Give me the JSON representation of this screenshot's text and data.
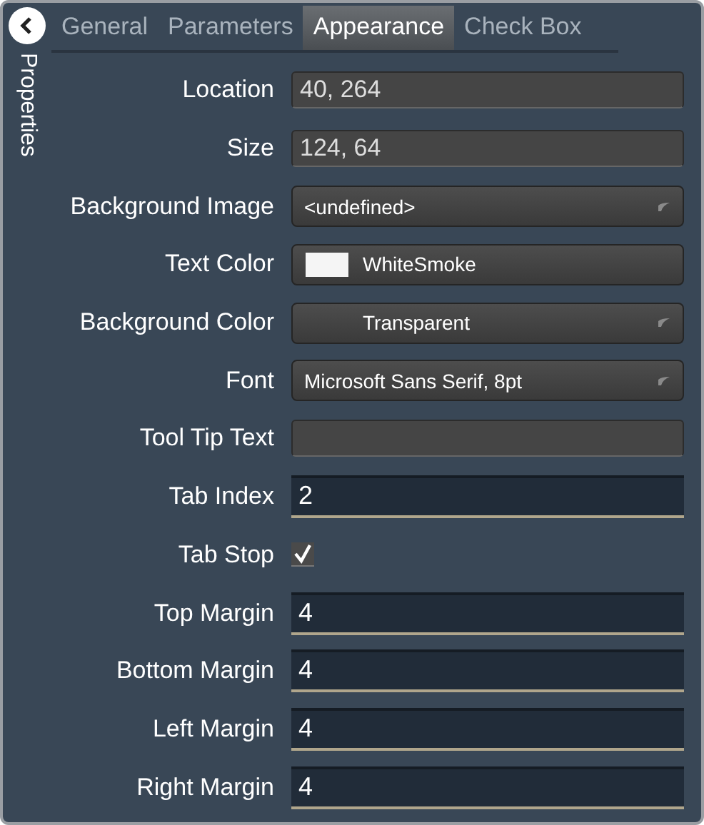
{
  "sidebar": {
    "title": "Properties"
  },
  "tabs": [
    {
      "label": "General",
      "selected": false
    },
    {
      "label": "Parameters",
      "selected": false
    },
    {
      "label": "Appearance",
      "selected": true
    },
    {
      "label": "Check Box",
      "selected": false
    }
  ],
  "properties": [
    {
      "label": "Location",
      "kind": "text",
      "value": "40, 264"
    },
    {
      "label": "Size",
      "kind": "text",
      "value": "124, 64"
    },
    {
      "label": "Background Image",
      "kind": "dropdown",
      "value": "<undefined>"
    },
    {
      "label": "Text Color",
      "kind": "color",
      "value": "WhiteSmoke",
      "color": "#f5f5f5",
      "dropdown": false
    },
    {
      "label": "Background Color",
      "kind": "color",
      "value": "Transparent",
      "dropdown": true
    },
    {
      "label": "Font",
      "kind": "dropdown",
      "value": "Microsoft Sans Serif, 8pt"
    },
    {
      "label": "Tool Tip Text",
      "kind": "text"
    },
    {
      "label": "Tab Index",
      "kind": "number",
      "value": "2"
    },
    {
      "label": "Tab Stop",
      "kind": "checkbox",
      "checked": true
    },
    {
      "label": "Top Margin",
      "kind": "number",
      "value": "4"
    },
    {
      "label": "Bottom Margin",
      "kind": "number",
      "value": "4"
    },
    {
      "label": "Left Margin",
      "kind": "number",
      "value": "4"
    },
    {
      "label": "Right Margin",
      "kind": "number",
      "value": "4"
    }
  ]
}
